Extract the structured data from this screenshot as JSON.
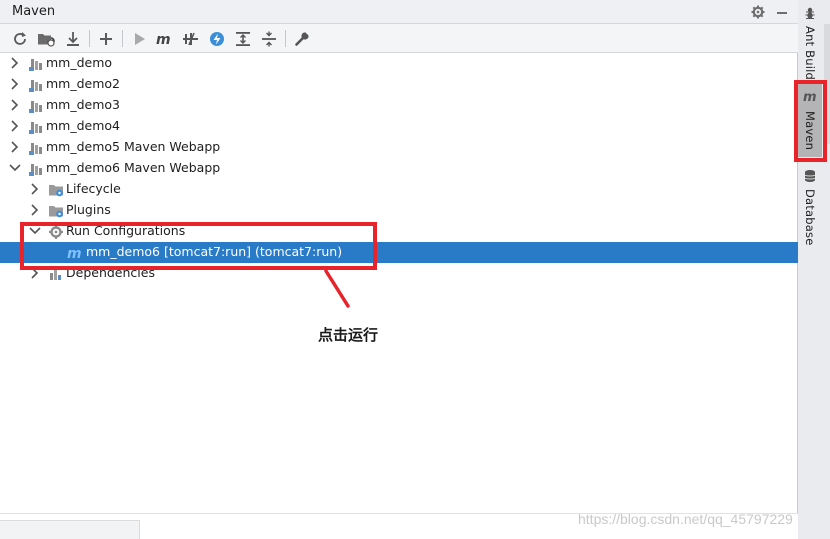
{
  "panel": {
    "title": "Maven",
    "settings_icon": "gear-icon",
    "minimize_icon": "minimize-icon"
  },
  "toolbar": {
    "tools": [
      {
        "name": "reimport-icon"
      },
      {
        "name": "generate-sources-icon"
      },
      {
        "name": "download-icon"
      },
      {
        "name": "add-icon"
      },
      {
        "name": "run-icon"
      },
      {
        "name": "execute-goal-icon"
      },
      {
        "name": "skip-tests-icon"
      },
      {
        "name": "offline-mode-icon"
      },
      {
        "name": "expand-all-icon"
      },
      {
        "name": "collapse-all-icon"
      },
      {
        "name": "settings-wrench-icon"
      }
    ]
  },
  "tree": {
    "items": [
      {
        "label": "mm_demo",
        "level": 0,
        "expanded": false,
        "icon": "maven-project-icon"
      },
      {
        "label": "mm_demo2",
        "level": 0,
        "expanded": false,
        "icon": "maven-project-icon"
      },
      {
        "label": "mm_demo3",
        "level": 0,
        "expanded": false,
        "icon": "maven-project-icon"
      },
      {
        "label": "mm_demo4",
        "level": 0,
        "expanded": false,
        "icon": "maven-project-icon"
      },
      {
        "label": "mm_demo5 Maven Webapp",
        "level": 0,
        "expanded": false,
        "icon": "maven-project-icon"
      },
      {
        "label": "mm_demo6 Maven Webapp",
        "level": 0,
        "expanded": true,
        "icon": "maven-project-icon"
      },
      {
        "label": "Lifecycle",
        "level": 1,
        "expanded": false,
        "icon": "lifecycle-folder-icon"
      },
      {
        "label": "Plugins",
        "level": 1,
        "expanded": false,
        "icon": "plugins-folder-icon"
      },
      {
        "label": "Run Configurations",
        "level": 1,
        "expanded": true,
        "icon": "run-config-gear-icon"
      },
      {
        "label": "mm_demo6 [tomcat7:run] (tomcat7:run)",
        "level": 2,
        "selected": true,
        "icon": "maven-goal-icon"
      },
      {
        "label": "Dependencies",
        "level": 1,
        "expanded": false,
        "icon": "dependencies-icon"
      }
    ]
  },
  "sidebar": {
    "tabs": [
      {
        "label": "Ant Build",
        "icon": "ant-icon",
        "active": false
      },
      {
        "label": "Maven",
        "icon": "maven-m-icon",
        "active": true
      },
      {
        "label": "Database",
        "icon": "database-icon",
        "active": false
      }
    ]
  },
  "annotation": {
    "text": "点击运行",
    "color": "#e8232a"
  },
  "watermark": {
    "text": "https://blog.csdn.net/qq_45797229"
  },
  "colors": {
    "selection": "#2a7bc7",
    "annotation_red": "#e8232a"
  }
}
